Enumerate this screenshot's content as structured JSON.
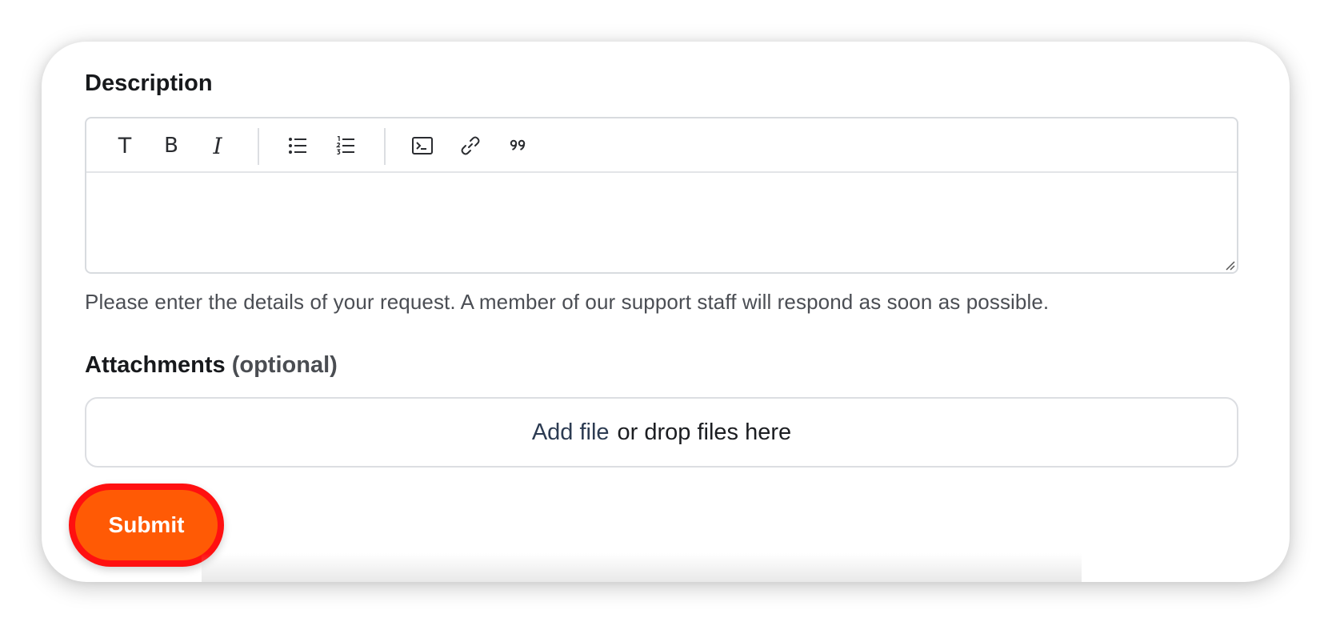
{
  "description": {
    "label": "Description",
    "hint": "Please enter the details of your request. A member of our support staff will respond as soon as possible."
  },
  "toolbar": {
    "text_label": "T",
    "bold_label": "B",
    "italic_label": "I"
  },
  "attachments": {
    "label": "Attachments",
    "optional": "(optional)",
    "add_file": "Add file",
    "drop_text": "or drop files here"
  },
  "submit": {
    "label": "Submit"
  },
  "colors": {
    "submit_bg": "#ff5a05",
    "submit_border": "#ff1010",
    "link": "#2c3b52"
  }
}
